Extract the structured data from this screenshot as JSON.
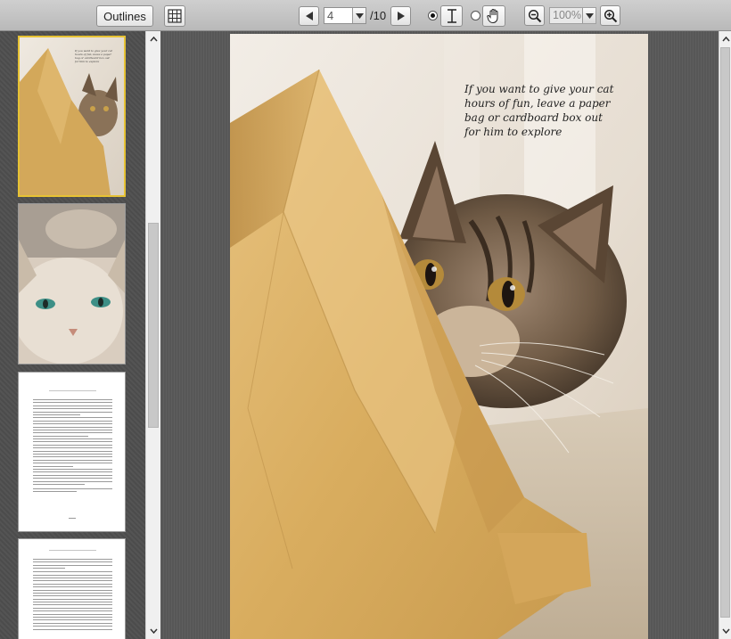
{
  "toolbar": {
    "outlines_label": "Outlines",
    "grid_icon": "thumbnail-grid-icon",
    "prev_icon": "triangle-left-icon",
    "next_icon": "triangle-right-icon",
    "current_page": "4",
    "total_pages": "/10",
    "text_select_icon": "text-cursor-icon",
    "hand_icon": "hand-icon",
    "zoom_out_icon": "zoom-out-icon",
    "zoom_in_icon": "zoom-in-icon",
    "zoom_value": "100%",
    "selected_tool": "text-select"
  },
  "thumbnails": [
    {
      "label": "page-1",
      "caption": "If you want to give your cat hours of fun, leave a paper bag or cardboard box out for him to explore",
      "active": true
    },
    {
      "label": "page-2",
      "caption": "",
      "active": false
    },
    {
      "label": "page-3",
      "caption": "",
      "active": false
    },
    {
      "label": "page-4",
      "caption": "",
      "active": false
    }
  ],
  "document": {
    "caption": "If you want to give your cat hours of fun, leave a paper bag or cardboard box out for him to explore"
  },
  "colors": {
    "toolbar_bg": "#c4c4c4",
    "sidebar_bg": "#4e4e4e",
    "active_thumb_border": "#e6c234",
    "main_bg": "#5a5a5a"
  }
}
